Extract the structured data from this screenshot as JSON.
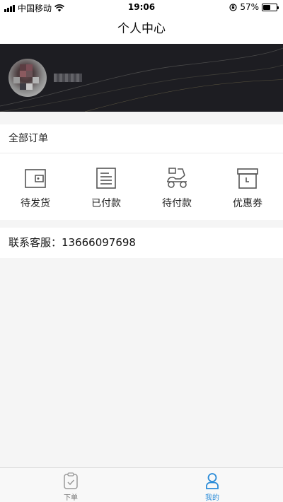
{
  "status_bar": {
    "carrier": "中国移动",
    "time": "19:06",
    "battery_percent": "57%",
    "battery_level": 0.57,
    "icons": [
      "signal-icon",
      "wifi-icon",
      "orientation-lock-icon",
      "battery-icon"
    ]
  },
  "nav": {
    "title": "个人中心"
  },
  "profile": {
    "avatar": "avatar",
    "username": ""
  },
  "orders": {
    "title": "全部订单",
    "items": [
      {
        "label": "待发货",
        "icon": "wallet-icon"
      },
      {
        "label": "已付款",
        "icon": "receipt-icon"
      },
      {
        "label": "待付款",
        "icon": "scooter-icon"
      },
      {
        "label": "优惠券",
        "icon": "box-icon"
      }
    ]
  },
  "contact": {
    "label": "联系客服：13666097698"
  },
  "tab_bar": {
    "tabs": [
      {
        "label": "下单",
        "icon": "clipboard-check-icon",
        "active": false
      },
      {
        "label": "我的",
        "icon": "user-icon",
        "active": true
      }
    ],
    "active_color": "#2a8bd8",
    "inactive_color": "#777777"
  }
}
